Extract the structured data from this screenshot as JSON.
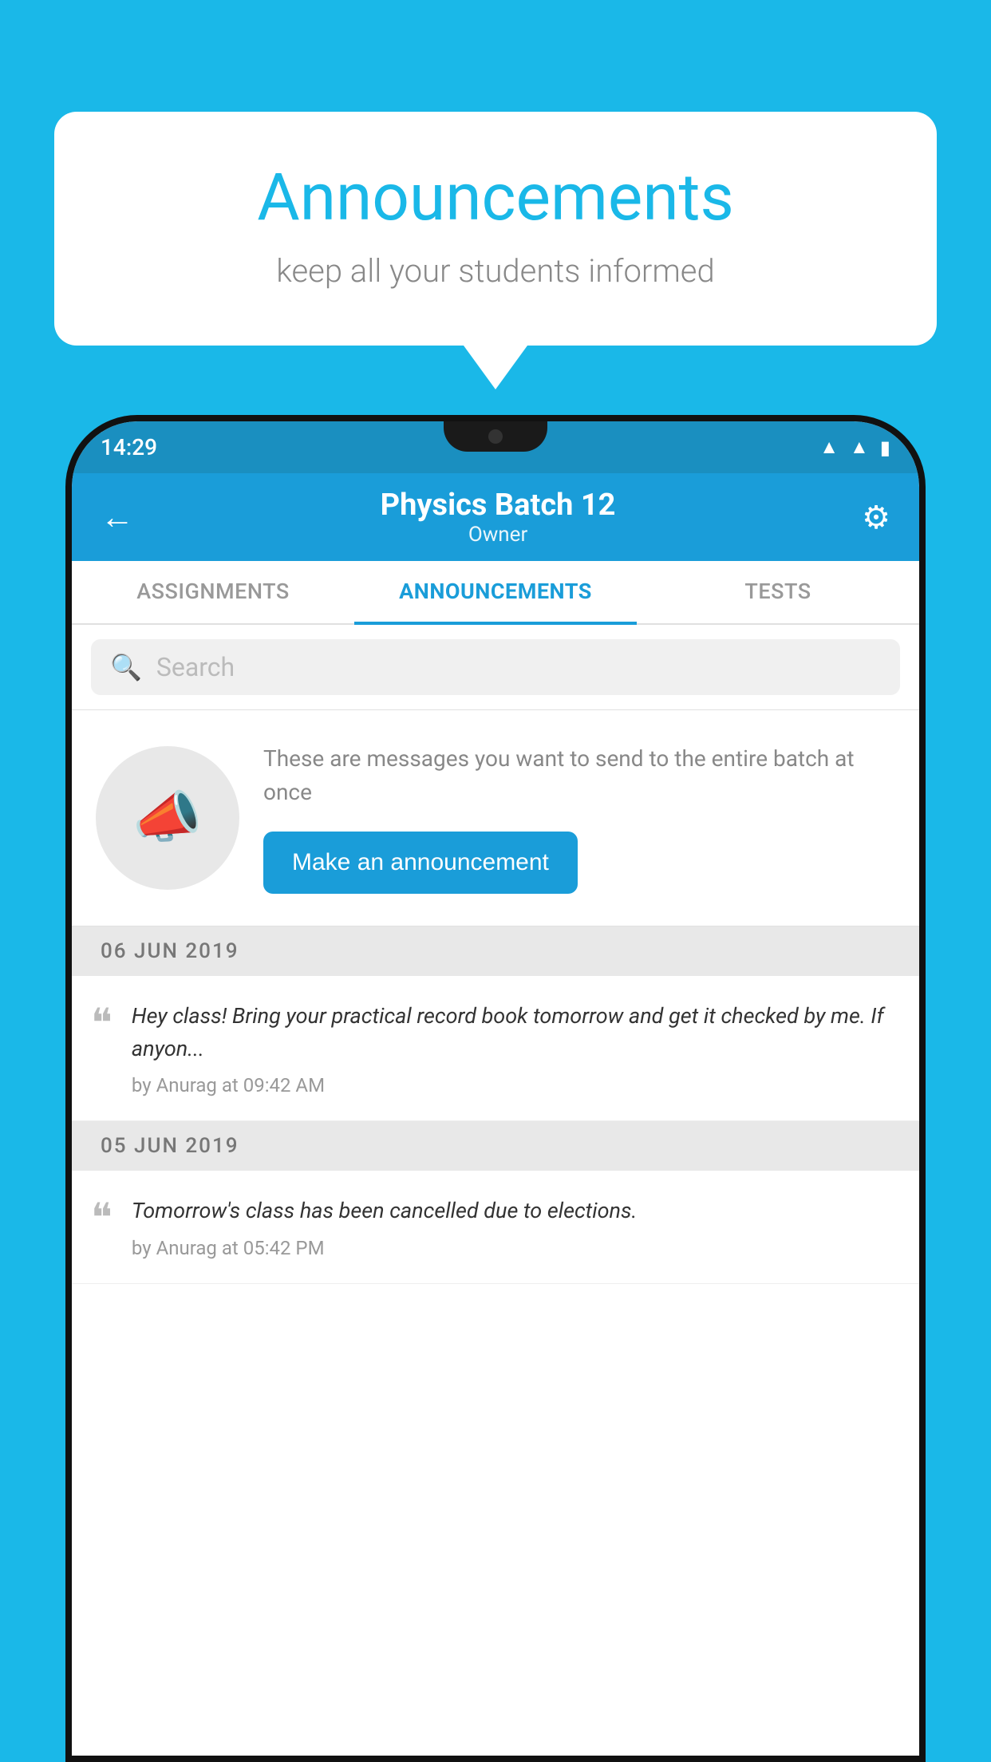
{
  "background_color": "#1ab8e8",
  "speech_bubble": {
    "title": "Announcements",
    "subtitle": "keep all your students informed"
  },
  "status_bar": {
    "time": "14:29",
    "wifi_icon": "▲",
    "signal_icon": "▲",
    "battery_icon": "▮"
  },
  "header": {
    "title": "Physics Batch 12",
    "subtitle": "Owner",
    "back_label": "←",
    "gear_label": "⚙"
  },
  "tabs": [
    {
      "id": "assignments",
      "label": "ASSIGNMENTS",
      "active": false
    },
    {
      "id": "announcements",
      "label": "ANNOUNCEMENTS",
      "active": true
    },
    {
      "id": "tests",
      "label": "TESTS",
      "active": false
    }
  ],
  "search": {
    "placeholder": "Search"
  },
  "promo": {
    "description": "These are messages you want to send to the entire batch at once",
    "button_label": "Make an announcement"
  },
  "announcements": [
    {
      "date": "06  JUN  2019",
      "items": [
        {
          "text": "Hey class! Bring your practical record book tomorrow and get it checked by me. If anyon...",
          "meta": "by Anurag at 09:42 AM"
        }
      ]
    },
    {
      "date": "05  JUN  2019",
      "items": [
        {
          "text": "Tomorrow's class has been cancelled due to elections.",
          "meta": "by Anurag at 05:42 PM"
        }
      ]
    }
  ]
}
